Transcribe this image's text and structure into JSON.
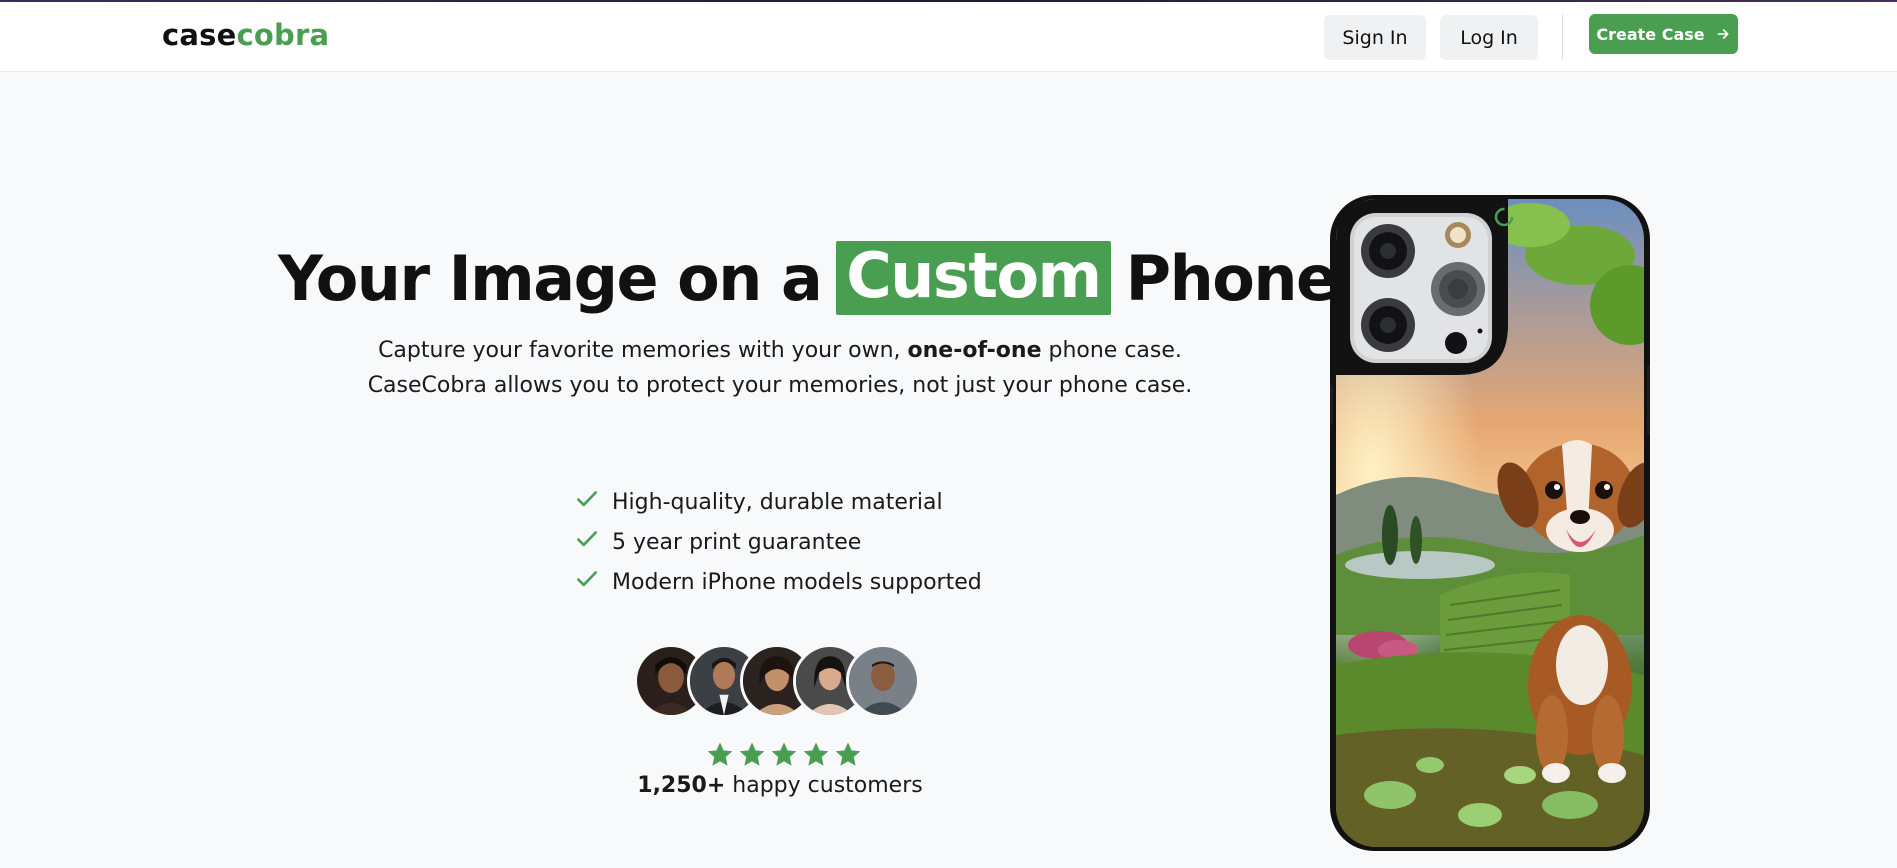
{
  "navbar": {
    "logo_part1": "case",
    "logo_part2": "cobra",
    "sign_in_label": "Sign In",
    "log_in_label": "Log In",
    "create_case_label": "Create Case",
    "create_case_icon": "arrow-right-icon"
  },
  "hero": {
    "title_before": "Your Image on a",
    "title_highlight": "Custom",
    "title_after": "Phone Case",
    "subtitle_line1_before": "Capture your favorite memories with your own,",
    "subtitle_line1_bold": "one-of-one",
    "subtitle_line1_after": "phone case.",
    "subtitle_line2": "CaseCobra allows you to protect your memories, not just your phone case."
  },
  "features": [
    {
      "label": "High-quality, durable material",
      "icon": "check-icon"
    },
    {
      "label": "5 year print guarantee",
      "icon": "check-icon"
    },
    {
      "label": "Modern iPhone models supported",
      "icon": "check-icon"
    }
  ],
  "social_proof": {
    "avatar_count": 5,
    "star_rating": 5,
    "customers_count": "1,250+",
    "customers_label": "happy customers"
  },
  "colors": {
    "accent": "#4a9e52",
    "text": "#111111",
    "background": "#f8f9fb"
  }
}
